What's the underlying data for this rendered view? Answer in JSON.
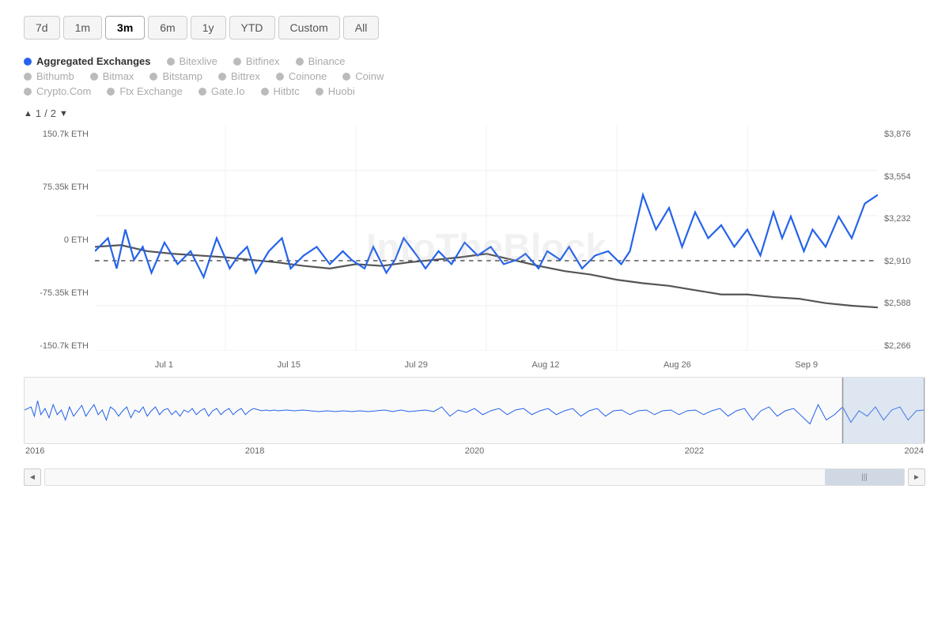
{
  "timeRange": {
    "buttons": [
      "7d",
      "1m",
      "3m",
      "6m",
      "1y",
      "YTD",
      "Custom",
      "All"
    ],
    "active": "3m"
  },
  "legend": {
    "row1": [
      {
        "id": "aggregated",
        "label": "Aggregated Exchanges",
        "active": true,
        "color": "blue"
      },
      {
        "id": "bitexlive",
        "label": "Bitexlive",
        "active": false,
        "color": "gray"
      },
      {
        "id": "bitfinex",
        "label": "Bitfinex",
        "active": false,
        "color": "gray"
      },
      {
        "id": "binance",
        "label": "Binance",
        "active": false,
        "color": "gray"
      }
    ],
    "row2": [
      {
        "id": "bithumb",
        "label": "Bithumb",
        "active": false,
        "color": "gray"
      },
      {
        "id": "bitmax",
        "label": "Bitmax",
        "active": false,
        "color": "gray"
      },
      {
        "id": "bitstamp",
        "label": "Bitstamp",
        "active": false,
        "color": "gray"
      },
      {
        "id": "bittrex",
        "label": "Bittrex",
        "active": false,
        "color": "gray"
      },
      {
        "id": "coinone",
        "label": "Coinone",
        "active": false,
        "color": "gray"
      },
      {
        "id": "coinw",
        "label": "Coinw",
        "active": false,
        "color": "gray"
      }
    ],
    "row3": [
      {
        "id": "cryptocom",
        "label": "Crypto.Com",
        "active": false,
        "color": "gray"
      },
      {
        "id": "ftx",
        "label": "Ftx Exchange",
        "active": false,
        "color": "gray"
      },
      {
        "id": "gateio",
        "label": "Gate.Io",
        "active": false,
        "color": "gray"
      },
      {
        "id": "hitbtc",
        "label": "Hitbtc",
        "active": false,
        "color": "gray"
      },
      {
        "id": "huobi",
        "label": "Huobi",
        "active": false,
        "color": "gray"
      }
    ]
  },
  "pageIndicator": {
    "current": 1,
    "total": 2
  },
  "yAxisLeft": [
    "150.7k ETH",
    "75.35k ETH",
    "0 ETH",
    "-75.35k ETH",
    "-150.7k ETH"
  ],
  "yAxisRight": [
    "$3,876",
    "$3,554",
    "$3,232",
    "$2,910",
    "$2,588",
    "$2,266"
  ],
  "xAxisLabels": [
    "Jul 1",
    "Jul 15",
    "Jul 29",
    "Aug 12",
    "Aug 26",
    "Sep 9"
  ],
  "navXLabels": [
    "2016",
    "2018",
    "2020",
    "2022",
    "2024"
  ],
  "watermark": "IntoTheBlock",
  "scrollbar": {
    "leftBtn": "◄",
    "rightBtn": "►",
    "centerHandle": "|||"
  }
}
